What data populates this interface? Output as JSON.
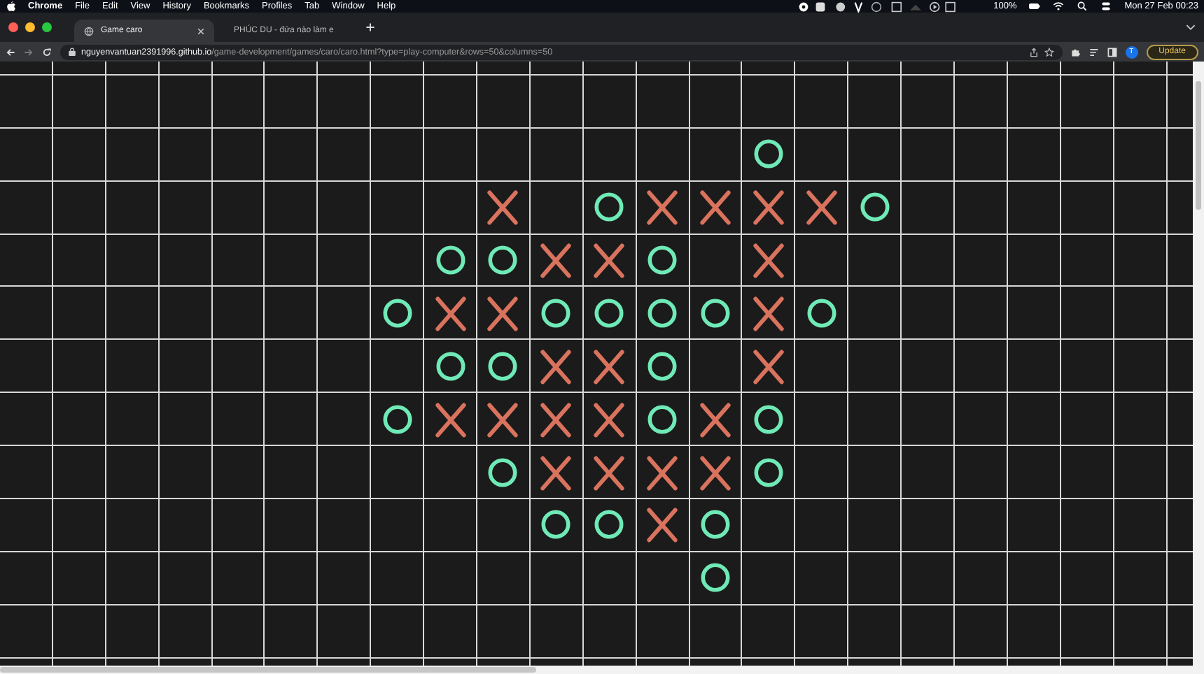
{
  "menu_bar": {
    "items": [
      "Chrome",
      "File",
      "Edit",
      "View",
      "History",
      "Bookmarks",
      "Profiles",
      "Tab",
      "Window",
      "Help"
    ],
    "battery": "100%",
    "clock": "Mon 27 Feb  00:23"
  },
  "tabs": [
    {
      "title": "Game caro",
      "selected": true,
      "kind": "globe"
    },
    {
      "title": "PHÚC DU - đứa nào làm e",
      "selected": false,
      "kind": "video"
    }
  ],
  "address_bar": {
    "host": "nguyenvantuan2391996.github.io",
    "path": "/game-development/games/caro/caro.html?type=play-computer&rows=50&columns=50",
    "profile": "T",
    "update": "Update"
  },
  "board": {
    "rows": [
      {
        "cells": [
          {
            "kind": "empty"
          },
          {
            "kind": "empty"
          },
          {
            "kind": "empty"
          },
          {
            "kind": "empty"
          },
          {
            "kind": "empty"
          },
          {
            "kind": "empty"
          },
          {
            "kind": "empty"
          },
          {
            "kind": "empty"
          },
          {
            "kind": "empty"
          },
          {
            "kind": "empty"
          },
          {
            "kind": "empty"
          },
          {
            "kind": "empty"
          },
          {
            "kind": "empty"
          },
          {
            "kind": "empty"
          },
          {
            "kind": "empty"
          },
          {
            "kind": "empty"
          },
          {
            "kind": "empty"
          },
          {
            "kind": "empty"
          },
          {
            "kind": "empty"
          },
          {
            "kind": "empty"
          },
          {
            "kind": "empty"
          },
          {
            "kind": "empty"
          },
          {
            "kind": "empty"
          }
        ]
      },
      {
        "cells": [
          {
            "kind": "empty"
          },
          {
            "kind": "empty"
          },
          {
            "kind": "empty"
          },
          {
            "kind": "empty"
          },
          {
            "kind": "empty"
          },
          {
            "kind": "empty"
          },
          {
            "kind": "empty"
          },
          {
            "kind": "empty"
          },
          {
            "kind": "empty"
          },
          {
            "kind": "empty"
          },
          {
            "kind": "empty"
          },
          {
            "kind": "empty"
          },
          {
            "kind": "empty"
          },
          {
            "kind": "empty"
          },
          {
            "kind": "empty"
          },
          {
            "kind": "empty"
          },
          {
            "kind": "empty"
          },
          {
            "kind": "empty"
          },
          {
            "kind": "empty"
          },
          {
            "kind": "empty"
          },
          {
            "kind": "empty"
          },
          {
            "kind": "empty"
          },
          {
            "kind": "empty"
          }
        ]
      },
      {
        "cells": [
          {
            "kind": "empty"
          },
          {
            "kind": "empty"
          },
          {
            "kind": "empty"
          },
          {
            "kind": "empty"
          },
          {
            "kind": "empty"
          },
          {
            "kind": "empty"
          },
          {
            "kind": "empty"
          },
          {
            "kind": "empty"
          },
          {
            "kind": "empty"
          },
          {
            "kind": "empty"
          },
          {
            "kind": "empty"
          },
          {
            "kind": "empty"
          },
          {
            "kind": "empty"
          },
          {
            "kind": "empty"
          },
          {
            "kind": "ring"
          },
          {
            "kind": "empty"
          },
          {
            "kind": "empty"
          },
          {
            "kind": "empty"
          },
          {
            "kind": "empty"
          },
          {
            "kind": "empty"
          },
          {
            "kind": "empty"
          },
          {
            "kind": "empty"
          },
          {
            "kind": "empty"
          }
        ]
      },
      {
        "cells": [
          {
            "kind": "empty"
          },
          {
            "kind": "empty"
          },
          {
            "kind": "empty"
          },
          {
            "kind": "empty"
          },
          {
            "kind": "empty"
          },
          {
            "kind": "empty"
          },
          {
            "kind": "empty"
          },
          {
            "kind": "empty"
          },
          {
            "kind": "empty"
          },
          {
            "kind": "cross"
          },
          {
            "kind": "empty"
          },
          {
            "kind": "ring"
          },
          {
            "kind": "cross"
          },
          {
            "kind": "cross"
          },
          {
            "kind": "cross"
          },
          {
            "kind": "cross"
          },
          {
            "kind": "ring"
          },
          {
            "kind": "empty"
          },
          {
            "kind": "empty"
          },
          {
            "kind": "empty"
          },
          {
            "kind": "empty"
          },
          {
            "kind": "empty"
          },
          {
            "kind": "empty"
          }
        ]
      },
      {
        "cells": [
          {
            "kind": "empty"
          },
          {
            "kind": "empty"
          },
          {
            "kind": "empty"
          },
          {
            "kind": "empty"
          },
          {
            "kind": "empty"
          },
          {
            "kind": "empty"
          },
          {
            "kind": "empty"
          },
          {
            "kind": "empty"
          },
          {
            "kind": "ring"
          },
          {
            "kind": "ring"
          },
          {
            "kind": "cross"
          },
          {
            "kind": "cross"
          },
          {
            "kind": "ring"
          },
          {
            "kind": "empty"
          },
          {
            "kind": "cross"
          },
          {
            "kind": "empty"
          },
          {
            "kind": "empty"
          },
          {
            "kind": "empty"
          },
          {
            "kind": "empty"
          },
          {
            "kind": "empty"
          },
          {
            "kind": "empty"
          },
          {
            "kind": "empty"
          },
          {
            "kind": "empty"
          }
        ]
      },
      {
        "cells": [
          {
            "kind": "empty"
          },
          {
            "kind": "empty"
          },
          {
            "kind": "empty"
          },
          {
            "kind": "empty"
          },
          {
            "kind": "empty"
          },
          {
            "kind": "empty"
          },
          {
            "kind": "empty"
          },
          {
            "kind": "ring"
          },
          {
            "kind": "cross"
          },
          {
            "kind": "cross"
          },
          {
            "kind": "ring"
          },
          {
            "kind": "ring"
          },
          {
            "kind": "ring"
          },
          {
            "kind": "ring"
          },
          {
            "kind": "cross"
          },
          {
            "kind": "ring"
          },
          {
            "kind": "empty"
          },
          {
            "kind": "empty"
          },
          {
            "kind": "empty"
          },
          {
            "kind": "empty"
          },
          {
            "kind": "empty"
          },
          {
            "kind": "empty"
          },
          {
            "kind": "empty"
          }
        ]
      },
      {
        "cells": [
          {
            "kind": "empty"
          },
          {
            "kind": "empty"
          },
          {
            "kind": "empty"
          },
          {
            "kind": "empty"
          },
          {
            "kind": "empty"
          },
          {
            "kind": "empty"
          },
          {
            "kind": "empty"
          },
          {
            "kind": "empty"
          },
          {
            "kind": "ring"
          },
          {
            "kind": "ring"
          },
          {
            "kind": "cross"
          },
          {
            "kind": "cross"
          },
          {
            "kind": "ring"
          },
          {
            "kind": "empty"
          },
          {
            "kind": "cross"
          },
          {
            "kind": "empty"
          },
          {
            "kind": "empty"
          },
          {
            "kind": "empty"
          },
          {
            "kind": "empty"
          },
          {
            "kind": "empty"
          },
          {
            "kind": "empty"
          },
          {
            "kind": "empty"
          },
          {
            "kind": "empty"
          }
        ]
      },
      {
        "cells": [
          {
            "kind": "empty"
          },
          {
            "kind": "empty"
          },
          {
            "kind": "empty"
          },
          {
            "kind": "empty"
          },
          {
            "kind": "empty"
          },
          {
            "kind": "empty"
          },
          {
            "kind": "empty"
          },
          {
            "kind": "ring"
          },
          {
            "kind": "cross"
          },
          {
            "kind": "cross"
          },
          {
            "kind": "cross"
          },
          {
            "kind": "cross"
          },
          {
            "kind": "ring"
          },
          {
            "kind": "cross"
          },
          {
            "kind": "ring"
          },
          {
            "kind": "empty"
          },
          {
            "kind": "empty"
          },
          {
            "kind": "empty"
          },
          {
            "kind": "empty"
          },
          {
            "kind": "empty"
          },
          {
            "kind": "empty"
          },
          {
            "kind": "empty"
          },
          {
            "kind": "empty"
          }
        ]
      },
      {
        "cells": [
          {
            "kind": "empty"
          },
          {
            "kind": "empty"
          },
          {
            "kind": "empty"
          },
          {
            "kind": "empty"
          },
          {
            "kind": "empty"
          },
          {
            "kind": "empty"
          },
          {
            "kind": "empty"
          },
          {
            "kind": "empty"
          },
          {
            "kind": "empty"
          },
          {
            "kind": "ring"
          },
          {
            "kind": "cross"
          },
          {
            "kind": "cross"
          },
          {
            "kind": "cross"
          },
          {
            "kind": "cross"
          },
          {
            "kind": "ring"
          },
          {
            "kind": "empty"
          },
          {
            "kind": "empty"
          },
          {
            "kind": "empty"
          },
          {
            "kind": "empty"
          },
          {
            "kind": "empty"
          },
          {
            "kind": "empty"
          },
          {
            "kind": "empty"
          },
          {
            "kind": "empty"
          }
        ]
      },
      {
        "cells": [
          {
            "kind": "empty"
          },
          {
            "kind": "empty"
          },
          {
            "kind": "empty"
          },
          {
            "kind": "empty"
          },
          {
            "kind": "empty"
          },
          {
            "kind": "empty"
          },
          {
            "kind": "empty"
          },
          {
            "kind": "empty"
          },
          {
            "kind": "empty"
          },
          {
            "kind": "empty"
          },
          {
            "kind": "ring"
          },
          {
            "kind": "ring"
          },
          {
            "kind": "cross"
          },
          {
            "kind": "ring"
          },
          {
            "kind": "empty"
          },
          {
            "kind": "empty"
          },
          {
            "kind": "empty"
          },
          {
            "kind": "empty"
          },
          {
            "kind": "empty"
          },
          {
            "kind": "empty"
          },
          {
            "kind": "empty"
          },
          {
            "kind": "empty"
          },
          {
            "kind": "empty"
          }
        ]
      },
      {
        "cells": [
          {
            "kind": "empty"
          },
          {
            "kind": "empty"
          },
          {
            "kind": "empty"
          },
          {
            "kind": "empty"
          },
          {
            "kind": "empty"
          },
          {
            "kind": "empty"
          },
          {
            "kind": "empty"
          },
          {
            "kind": "empty"
          },
          {
            "kind": "empty"
          },
          {
            "kind": "empty"
          },
          {
            "kind": "empty"
          },
          {
            "kind": "empty"
          },
          {
            "kind": "empty"
          },
          {
            "kind": "ring"
          },
          {
            "kind": "empty"
          },
          {
            "kind": "empty"
          },
          {
            "kind": "empty"
          },
          {
            "kind": "empty"
          },
          {
            "kind": "empty"
          },
          {
            "kind": "empty"
          },
          {
            "kind": "empty"
          },
          {
            "kind": "empty"
          },
          {
            "kind": "empty"
          }
        ]
      },
      {
        "cells": [
          {
            "kind": "empty"
          },
          {
            "kind": "empty"
          },
          {
            "kind": "empty"
          },
          {
            "kind": "empty"
          },
          {
            "kind": "empty"
          },
          {
            "kind": "empty"
          },
          {
            "kind": "empty"
          },
          {
            "kind": "empty"
          },
          {
            "kind": "empty"
          },
          {
            "kind": "empty"
          },
          {
            "kind": "empty"
          },
          {
            "kind": "empty"
          },
          {
            "kind": "empty"
          },
          {
            "kind": "empty"
          },
          {
            "kind": "empty"
          },
          {
            "kind": "empty"
          },
          {
            "kind": "empty"
          },
          {
            "kind": "empty"
          },
          {
            "kind": "empty"
          },
          {
            "kind": "empty"
          },
          {
            "kind": "empty"
          },
          {
            "kind": "empty"
          },
          {
            "kind": "empty"
          }
        ]
      },
      {
        "cells": [
          {
            "kind": "empty"
          },
          {
            "kind": "empty"
          },
          {
            "kind": "empty"
          },
          {
            "kind": "empty"
          },
          {
            "kind": "empty"
          },
          {
            "kind": "empty"
          },
          {
            "kind": "empty"
          },
          {
            "kind": "empty"
          },
          {
            "kind": "empty"
          },
          {
            "kind": "empty"
          },
          {
            "kind": "empty"
          },
          {
            "kind": "empty"
          },
          {
            "kind": "empty"
          },
          {
            "kind": "empty"
          },
          {
            "kind": "empty"
          },
          {
            "kind": "empty"
          },
          {
            "kind": "empty"
          },
          {
            "kind": "empty"
          },
          {
            "kind": "empty"
          },
          {
            "kind": "empty"
          },
          {
            "kind": "empty"
          },
          {
            "kind": "empty"
          },
          {
            "kind": "empty"
          }
        ]
      }
    ]
  }
}
